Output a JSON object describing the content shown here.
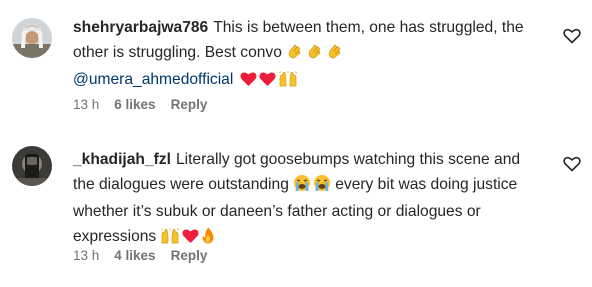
{
  "comments": [
    {
      "username": "shehryarbajwa786",
      "text": "This is between them, one has struggled, the other is struggling. Best convo",
      "mention": "@umera_ahmedofficial",
      "emoji_line1": [
        "clapping-hands",
        "clapping-hands",
        "clapping-hands"
      ],
      "emoji_line2": [
        "red-heart",
        "red-heart",
        "raising-hands"
      ],
      "time": "13 h",
      "likes": "6 likes",
      "reply": "Reply"
    },
    {
      "username": "_khadijah_fzl",
      "text_a": "Literally got goosebumps watching this scene and the dialogues were outstanding",
      "text_b": "every bit was doing justice whether it’s subuk or daneen’s father acting or dialogues or expressions",
      "emoji_mid": [
        "loudly-crying-face",
        "loudly-crying-face"
      ],
      "emoji_end": [
        "raising-hands",
        "red-heart",
        "fire"
      ],
      "time": "13 h",
      "likes": "4 likes",
      "reply": "Reply"
    }
  ],
  "colors": {
    "text": "#262626",
    "meta": "#737373",
    "mention": "#00376b",
    "heart": "#ed1c3a",
    "clap": "#f7c12c",
    "fire": "#ff8a00"
  }
}
